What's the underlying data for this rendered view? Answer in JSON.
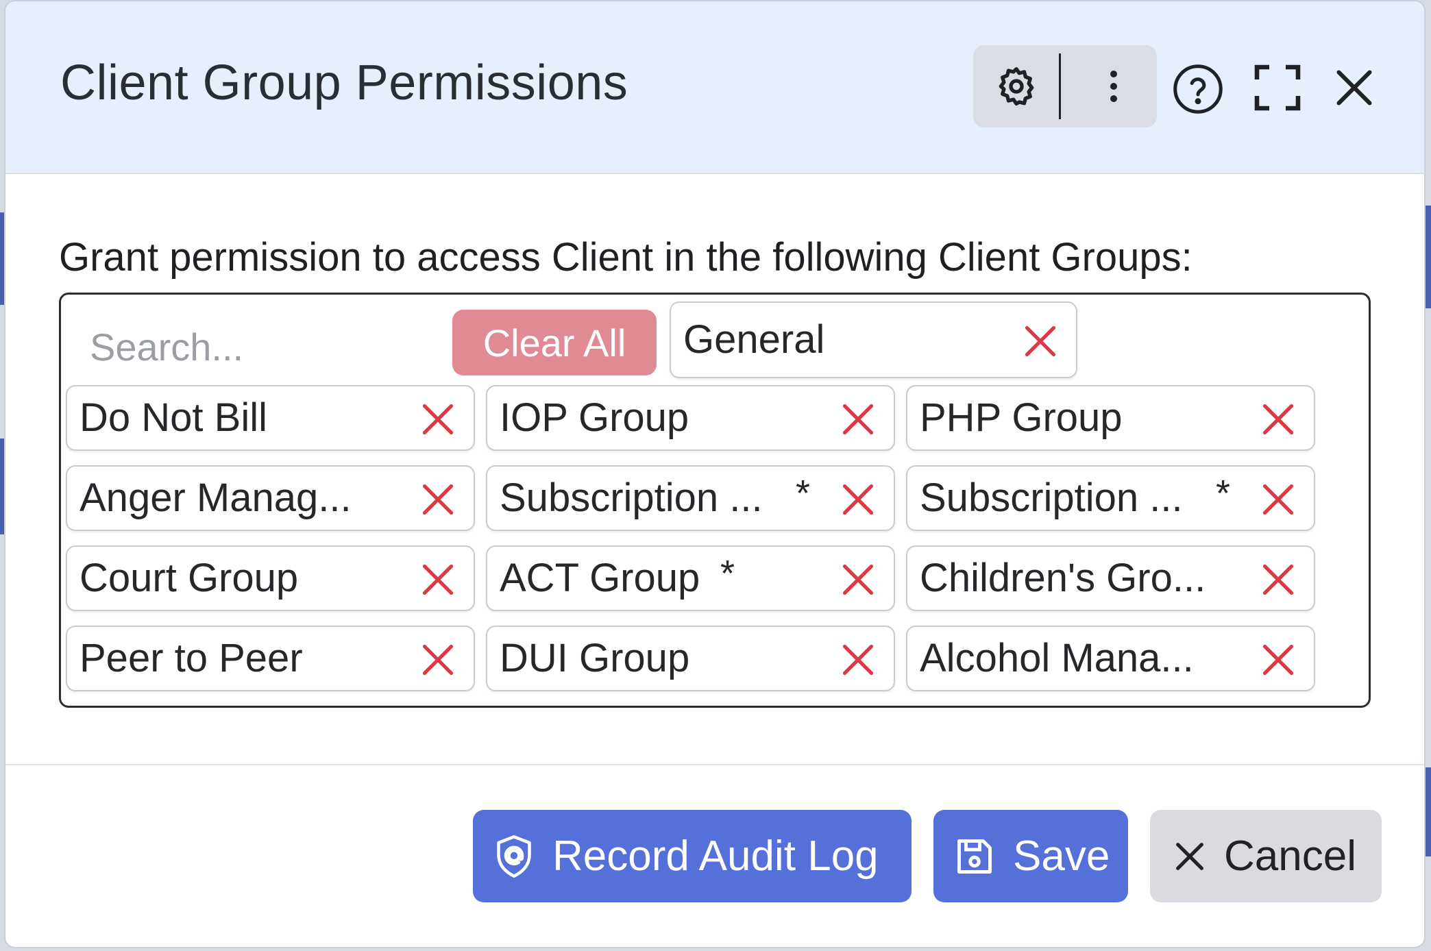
{
  "dialog": {
    "title": "Client Group Permissions",
    "icons": {
      "settings": "gear-icon",
      "more": "vertical-dots-icon",
      "help": "question-circle-icon",
      "fullscreen": "expand-icon",
      "close": "close-icon"
    }
  },
  "permissions": {
    "label": "Grant permission to access Client in the following Client Groups:",
    "search_placeholder": "Search...",
    "clear_all_label": "Clear All",
    "tags": [
      {
        "label": "General",
        "starred": false
      },
      {
        "label": "Do Not Bill",
        "starred": false
      },
      {
        "label": "IOP Group",
        "starred": false
      },
      {
        "label": "PHP Group",
        "starred": false
      },
      {
        "label": "Anger Manag...",
        "starred": false
      },
      {
        "label": "Subscription ...",
        "starred": true
      },
      {
        "label": "Subscription ...",
        "starred": true
      },
      {
        "label": "Court Group",
        "starred": false
      },
      {
        "label": "ACT Group",
        "starred": true
      },
      {
        "label": "Children's Gro...",
        "starred": false
      },
      {
        "label": "Peer to Peer",
        "starred": false
      },
      {
        "label": "DUI Group",
        "starred": false
      },
      {
        "label": "Alcohol Mana...",
        "starred": false
      }
    ],
    "star_symbol": "*"
  },
  "footer": {
    "record_audit_label": "Record Audit Log",
    "save_label": "Save",
    "cancel_label": "Cancel"
  },
  "colors": {
    "header_bg": "#e8effc",
    "primary": "#5570d9",
    "clear_all": "#e08a93",
    "remove_x": "#d93a45"
  }
}
